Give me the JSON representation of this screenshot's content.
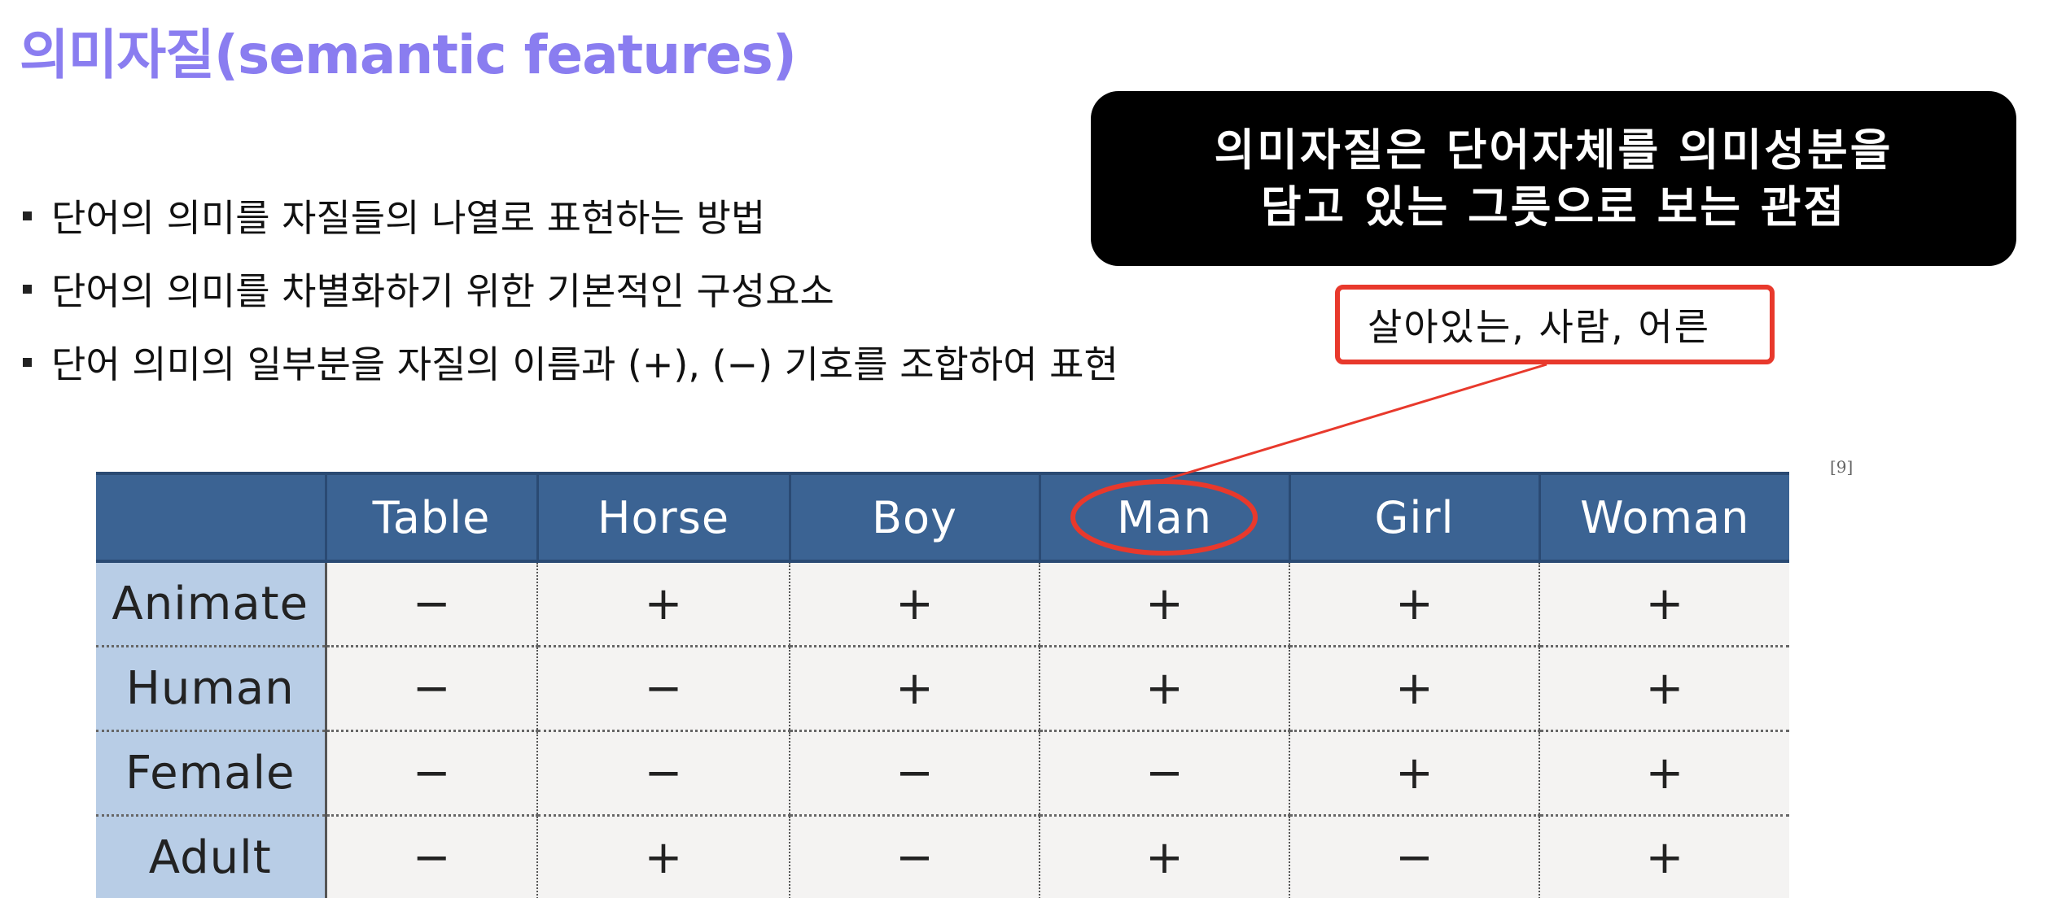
{
  "title": "의미자질(semantic features)",
  "bullets": [
    "단어의 의미를 자질들의 나열로 표현하는 방법",
    "단어의 의미를 차별화하기 위한 기본적인 구성요소",
    "단어 의미의 일부분을 자질의 이름과 (+), (−) 기호를 조합하여 표현"
  ],
  "callout": {
    "line1": "의미자질은 단어자체를 의미성분을",
    "line2": "담고 있는 그릇으로 보는 관점"
  },
  "annotation": "살아있는, 사람, 어른",
  "reference": "[9]",
  "colors": {
    "title": "#8a7df0",
    "header": "#3b6393",
    "row_header": "#b8cde6",
    "highlight": "#e8392c"
  },
  "table": {
    "columns": [
      "Table",
      "Horse",
      "Boy",
      "Man",
      "Girl",
      "Woman"
    ],
    "highlighted_column": "Man",
    "rows": [
      {
        "feature": "Animate",
        "values": [
          "−",
          "+",
          "+",
          "+",
          "+",
          "+"
        ]
      },
      {
        "feature": "Human",
        "values": [
          "−",
          "−",
          "+",
          "+",
          "+",
          "+"
        ]
      },
      {
        "feature": "Female",
        "values": [
          "−",
          "−",
          "−",
          "−",
          "+",
          "+"
        ]
      },
      {
        "feature": "Adult",
        "values": [
          "−",
          "+",
          "−",
          "+",
          "−",
          "+"
        ]
      }
    ]
  }
}
